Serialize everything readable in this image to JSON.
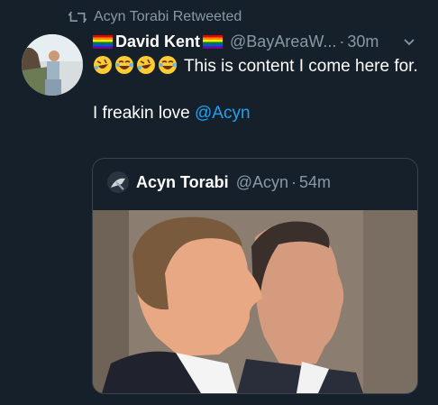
{
  "retweet": {
    "label": "Acyn Torabi Retweeted"
  },
  "tweet": {
    "display_name": "David Kent",
    "handle": "@BayAreaW...",
    "dot": "·",
    "time": "30m",
    "text_line1": "This is content I come here for.",
    "text_line2": "I freakin love ",
    "mention": "@Acyn"
  },
  "quote": {
    "display_name": "Acyn Torabi",
    "handle": "@Acyn",
    "dot": "·",
    "time": "54m"
  },
  "colors": {
    "background": "#15202b",
    "secondary_text": "#8899a6",
    "link": "#1da1f2",
    "border": "#38444d"
  },
  "icons": [
    "retweet-icon",
    "rainbow-flag-icon",
    "rolling-laughing-emoji",
    "tears-of-joy-emoji",
    "chevron-down-icon"
  ]
}
